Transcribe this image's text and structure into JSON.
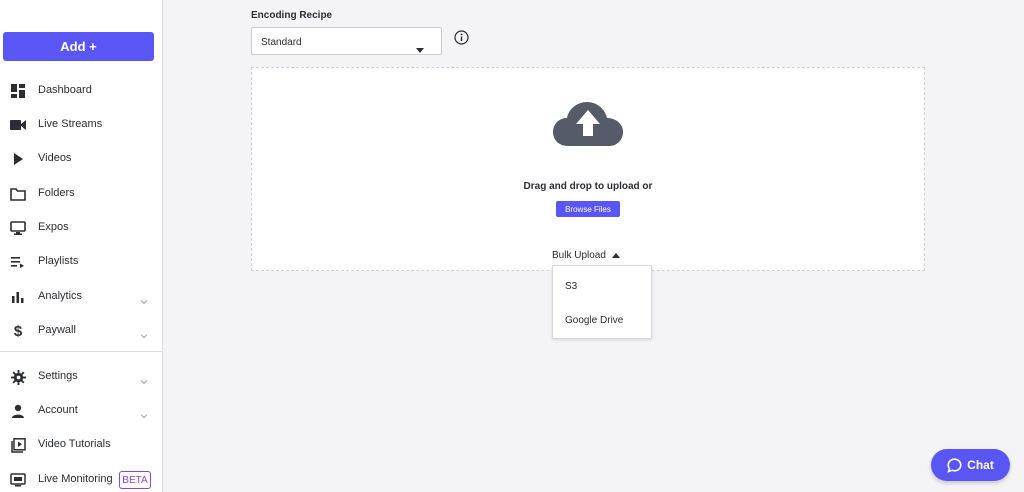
{
  "sidebar": {
    "add_label": "Add +",
    "items": [
      {
        "label": "Dashboard",
        "icon": "dashboard-icon"
      },
      {
        "label": "Live Streams",
        "icon": "camera-icon"
      },
      {
        "label": "Videos",
        "icon": "play-icon"
      },
      {
        "label": "Folders",
        "icon": "folder-icon"
      },
      {
        "label": "Expos",
        "icon": "monitor-icon"
      },
      {
        "label": "Playlists",
        "icon": "playlist-icon"
      },
      {
        "label": "Analytics",
        "icon": "bar-chart-icon"
      },
      {
        "label": "Paywall",
        "icon": "dollar-icon"
      },
      {
        "label": "Settings",
        "icon": "gear-icon"
      },
      {
        "label": "Account",
        "icon": "person-icon"
      },
      {
        "label": "Video Tutorials",
        "icon": "tutorial-icon"
      },
      {
        "label": "Live Monitoring",
        "icon": "monitoring-icon"
      }
    ],
    "beta_badge": "BETA"
  },
  "encoding": {
    "label": "Encoding Recipe",
    "selected": "Standard"
  },
  "upload": {
    "drag_text": "Drag and drop to upload or",
    "browse_label": "Browse Files",
    "bulk_label": "Bulk Upload",
    "bulk_options": [
      "S3",
      "Google Drive"
    ]
  },
  "chat": {
    "label": "Chat"
  },
  "colors": {
    "accent": "#5a55f5",
    "beta": "#8e44d8",
    "background": "#f4f4f7"
  }
}
